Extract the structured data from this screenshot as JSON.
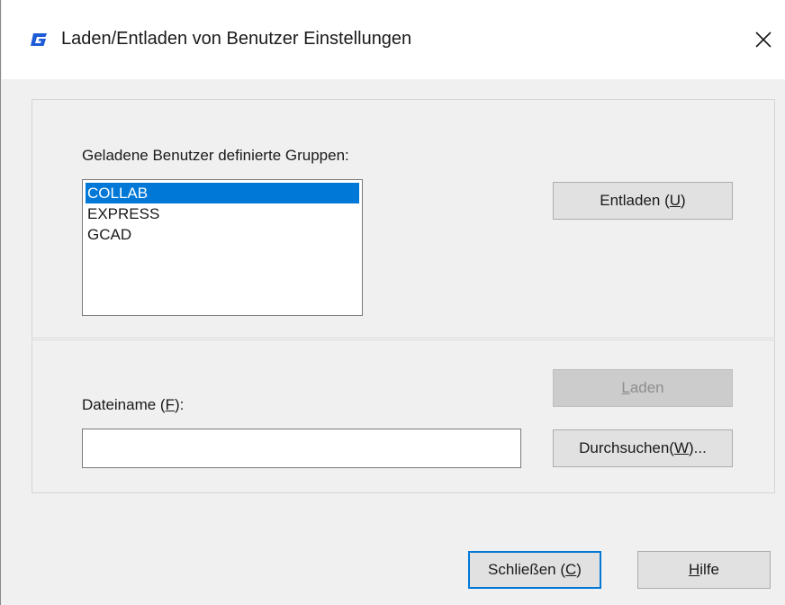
{
  "window": {
    "title": "Laden/Entladen von Benutzer Einstellungen",
    "app_icon": "gstarcad-g-icon",
    "close_icon": "close-icon"
  },
  "groups_section": {
    "label": "Geladene Benutzer definierte Gruppen:",
    "items": [
      "COLLAB",
      "EXPRESS",
      "GCAD"
    ],
    "selected_index": 0,
    "unload_button": {
      "pre": "Entladen (",
      "mnemonic": "U",
      "post": ")"
    }
  },
  "file_section": {
    "filename_label": {
      "pre": "Dateiname (",
      "mnemonic": "F",
      "post": "):"
    },
    "filename_value": "",
    "load_button": {
      "pre": "",
      "mnemonic": "L",
      "post": "aden",
      "enabled": false
    },
    "browse_button": {
      "pre": "Durchsuchen(",
      "mnemonic": "W",
      "post": ")..."
    }
  },
  "footer": {
    "close_button": {
      "pre": "Schließen (",
      "mnemonic": "C",
      "post": ")"
    },
    "help_button": {
      "pre": "",
      "mnemonic": "H",
      "post": "ilfe"
    }
  },
  "colors": {
    "accent": "#0078d7",
    "dialog_bg": "#f0f0f0",
    "icon_blue": "#1e5bd6"
  }
}
